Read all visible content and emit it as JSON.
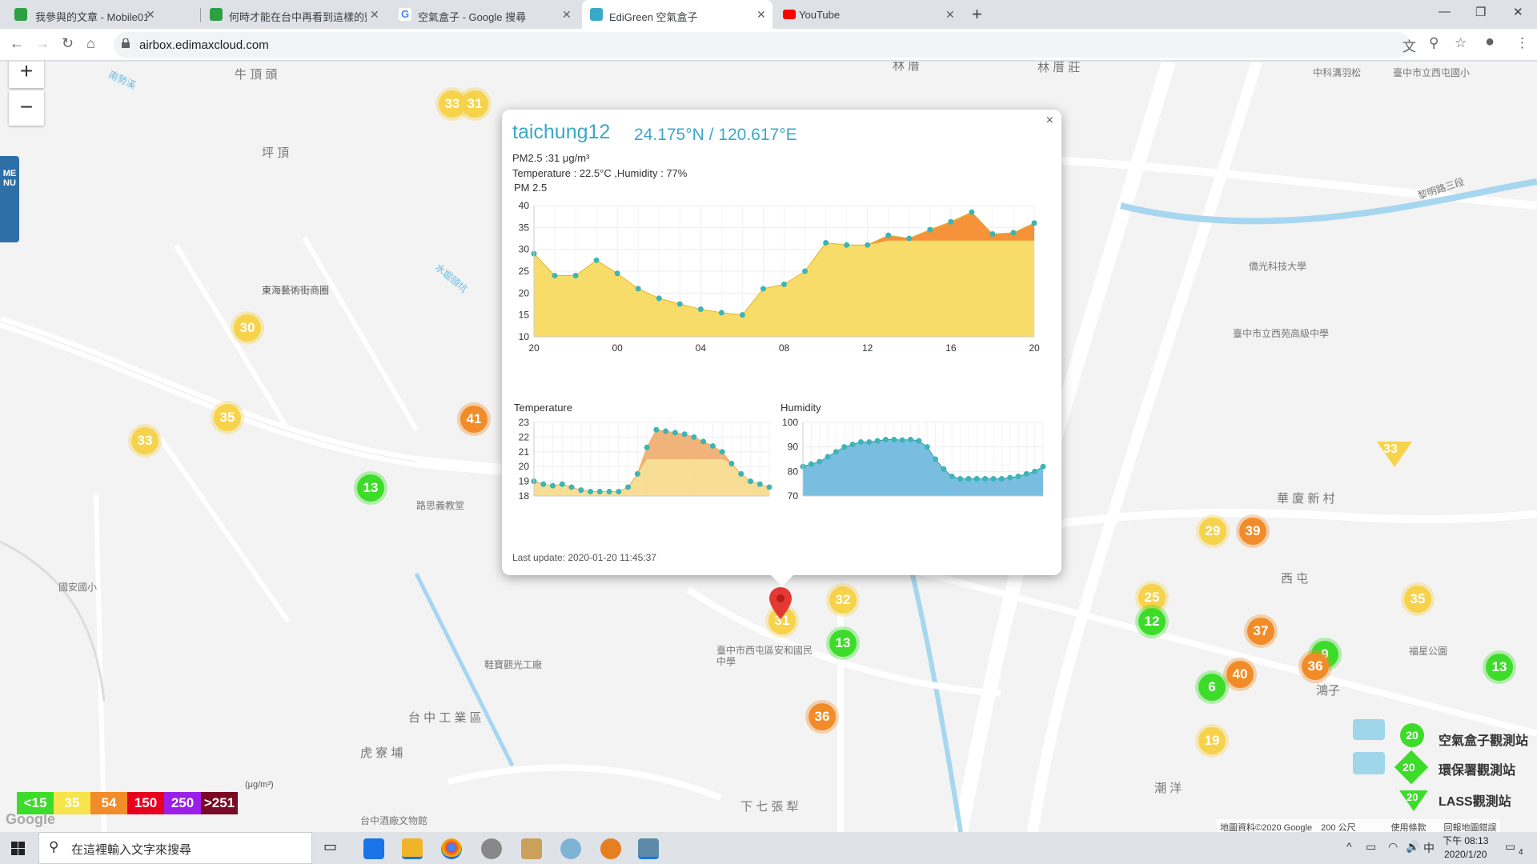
{
  "tabs": [
    {
      "label": "我參與的文章 - Mobile01",
      "icon_color": "#2ea043"
    },
    {
      "label": "何時才能在台中再看到這樣的藍天",
      "icon_color": "#2ea043"
    },
    {
      "label": "空氣盒子 - Google 搜尋",
      "icon": "google-icon"
    },
    {
      "label": "EdiGreen 空氣盒子",
      "icon_color": "#3aa8c9",
      "active": true
    },
    {
      "label": "YouTube",
      "icon_color": "#ff0000"
    }
  ],
  "url": "airbox.edimaxcloud.com",
  "map": {
    "labels": [
      "牛 頂 頭",
      "南勢溪",
      "坪 頂",
      "林 厝",
      "林 厝 莊",
      "東海藝術街商圈",
      "水堀頭坑",
      "路思義教堂",
      "台 中 工 業 區",
      "虎 寮 埔",
      "下 七 張 犁",
      "華 廈 新 村",
      "西 屯",
      "潮 洋",
      "鞋寶觀光工廠",
      "臺中市西屯區安和國民中學",
      "臺中市立西苑高級中學",
      "僑光科技大學",
      "臺中市立西屯國小",
      "黎明路三段",
      "台中酒廠文物館",
      "國安國小",
      "福星公園",
      "鴻子",
      "中科溝羽松"
    ],
    "markers": [
      {
        "v": "33",
        "c": "yellow"
      },
      {
        "v": "31",
        "c": "yellow"
      },
      {
        "v": "30",
        "c": "yellow"
      },
      {
        "v": "35",
        "c": "yellow"
      },
      {
        "v": "33",
        "c": "yellow"
      },
      {
        "v": "41",
        "c": "orange"
      },
      {
        "v": "13",
        "c": "green"
      },
      {
        "v": "32",
        "c": "yellow"
      },
      {
        "v": "31",
        "c": "yellow"
      },
      {
        "v": "13",
        "c": "green"
      },
      {
        "v": "36",
        "c": "orange"
      },
      {
        "v": "29",
        "c": "yellow"
      },
      {
        "v": "39",
        "c": "orange"
      },
      {
        "v": "25",
        "c": "yellow"
      },
      {
        "v": "12",
        "c": "green"
      },
      {
        "v": "37",
        "c": "orange"
      },
      {
        "v": "9",
        "c": "green"
      },
      {
        "v": "36",
        "c": "orange"
      },
      {
        "v": "40",
        "c": "orange"
      },
      {
        "v": "6",
        "c": "green"
      },
      {
        "v": "35",
        "c": "yellow"
      },
      {
        "v": "13",
        "c": "green"
      },
      {
        "v": "19",
        "c": "yellow"
      },
      {
        "v": "33",
        "c": "yellow"
      }
    ],
    "zoom_in": "+",
    "zoom_out": "−",
    "menu": "MENU"
  },
  "popup": {
    "site": "taichung12",
    "coord": "24.175°N / 120.617°E",
    "pm25_text": "PM2.5 :31 μg/m³",
    "temp_hum_text": "Temperature : 22.5°C ,Humidity : 77%",
    "close": "×",
    "last_update": "Last update: 2020-01-20 11:45:37"
  },
  "chart_data": [
    {
      "type": "area",
      "title": "PM 2.5",
      "x_ticks": [
        "20",
        "00",
        "04",
        "08",
        "12",
        "16",
        "20"
      ],
      "ylim": [
        10,
        40
      ],
      "y_ticks": [
        10,
        15,
        20,
        25,
        30,
        35,
        40
      ],
      "values": [
        29,
        24,
        24,
        27.5,
        24.5,
        21,
        18.8,
        17.5,
        16.3,
        15.5,
        15,
        21,
        22,
        25,
        31.5,
        31,
        31,
        33.2,
        32.5,
        34.5,
        36.3,
        38.5,
        33.5,
        33.8,
        36
      ]
    },
    {
      "type": "area",
      "title": "Temperature",
      "ylim": [
        18,
        23
      ],
      "y_ticks": [
        18,
        19,
        20,
        21,
        22,
        23
      ],
      "values": [
        19,
        18.8,
        18.7,
        18.8,
        18.6,
        18.4,
        18.3,
        18.3,
        18.3,
        18.3,
        18.6,
        19.5,
        21.3,
        22.5,
        22.4,
        22.3,
        22.2,
        22,
        21.7,
        21.4,
        21,
        20.2,
        19.5,
        19,
        18.8,
        18.6
      ]
    },
    {
      "type": "area",
      "title": "Humidity",
      "ylim": [
        70,
        100
      ],
      "y_ticks": [
        70,
        80,
        90,
        100
      ],
      "values": [
        82,
        83,
        84,
        86,
        88,
        90,
        91,
        92,
        92,
        92.5,
        93,
        93,
        92.8,
        93,
        92.5,
        90,
        85,
        81,
        78,
        77,
        77,
        77,
        77,
        77,
        77,
        77.5,
        78,
        79,
        80,
        82
      ]
    }
  ],
  "legend": {
    "scale": [
      "<15",
      "35",
      "54",
      "150",
      "250",
      ">251"
    ],
    "scale_colors": [
      "#3ddc2a",
      "#f7e34b",
      "#f28c28",
      "#e8001f",
      "#9b1fe8",
      "#7a0a23"
    ],
    "unit": "(μg/m³)",
    "items": [
      "空氣盒子觀測站",
      "環保署觀測站",
      "LASS觀測站"
    ],
    "item_values": [
      "20",
      "20",
      "20"
    ]
  },
  "attribution": "地圖資料©2020 Google　200 公尺　　　　使用條款　　回報地圖錯誤",
  "taskbar": {
    "search": "在這裡輸入文字來搜尋",
    "time": "下午 08:13",
    "date": "2020/1/20",
    "ime": "中",
    "notif": "4"
  }
}
